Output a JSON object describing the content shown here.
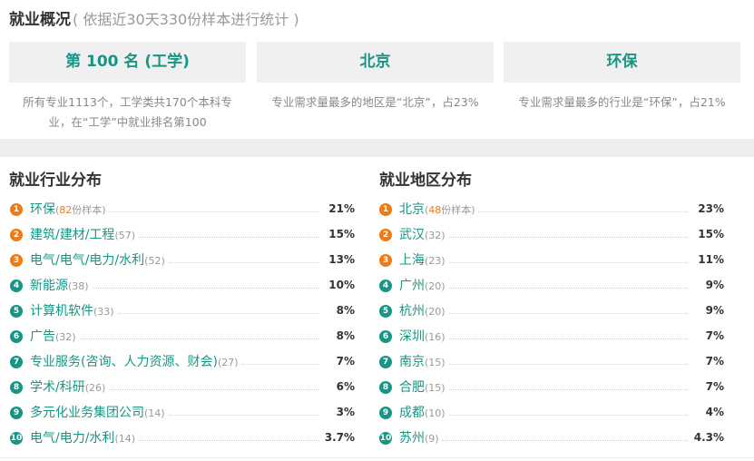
{
  "header": {
    "title": "就业概况",
    "subtitle": "( 依据近30天330份样本进行统计 )"
  },
  "cards": [
    {
      "value": "第 100 名 (工学)",
      "desc": "所有专业1113个，工学类共170个本科专业，在“工学”中就业排名第100"
    },
    {
      "value": "北京",
      "desc": "专业需求量最多的地区是“北京”，占23%"
    },
    {
      "value": "环保",
      "desc": "专业需求量最多的行业是“环保”，占21%"
    }
  ],
  "industry": {
    "title": "就业行业分布",
    "items": [
      {
        "rank": "1",
        "name": "环保",
        "pre": "(",
        "count": "82",
        "post": "份样本)",
        "pct": "21%"
      },
      {
        "rank": "2",
        "name": "建筑/建材/工程",
        "pre": "(",
        "count": "57",
        "post": ")",
        "pct": "15%"
      },
      {
        "rank": "3",
        "name": "电气/电气/电力/水利",
        "pre": "(",
        "count": "52",
        "post": ")",
        "pct": "13%"
      },
      {
        "rank": "4",
        "name": "新能源",
        "pre": "(",
        "count": "38",
        "post": ")",
        "pct": "10%"
      },
      {
        "rank": "5",
        "name": "计算机软件",
        "pre": "(",
        "count": "33",
        "post": ")",
        "pct": "8%"
      },
      {
        "rank": "6",
        "name": "广告",
        "pre": "(",
        "count": "32",
        "post": ")",
        "pct": "8%"
      },
      {
        "rank": "7",
        "name": "专业服务(咨询、人力资源、财会)",
        "pre": "(",
        "count": "27",
        "post": ")",
        "pct": "7%"
      },
      {
        "rank": "8",
        "name": "学术/科研",
        "pre": "(",
        "count": "26",
        "post": ")",
        "pct": "6%"
      },
      {
        "rank": "9",
        "name": "多元化业务集团公司",
        "pre": "(",
        "count": "14",
        "post": ")",
        "pct": "3%"
      },
      {
        "rank": "10",
        "name": "电气/电力/水利",
        "pre": "(",
        "count": "14",
        "post": ")",
        "pct": "3.7%"
      }
    ]
  },
  "region": {
    "title": "就业地区分布",
    "items": [
      {
        "rank": "1",
        "name": "北京",
        "pre": "(",
        "count": "48",
        "post": "份样本)",
        "pct": "23%"
      },
      {
        "rank": "2",
        "name": "武汉",
        "pre": "(",
        "count": "32",
        "post": ")",
        "pct": "15%"
      },
      {
        "rank": "3",
        "name": "上海",
        "pre": "(",
        "count": "23",
        "post": ")",
        "pct": "11%"
      },
      {
        "rank": "4",
        "name": "广州",
        "pre": "(",
        "count": "20",
        "post": ")",
        "pct": "9%"
      },
      {
        "rank": "5",
        "name": "杭州",
        "pre": "(",
        "count": "20",
        "post": ")",
        "pct": "9%"
      },
      {
        "rank": "6",
        "name": "深圳",
        "pre": "(",
        "count": "16",
        "post": ")",
        "pct": "7%"
      },
      {
        "rank": "7",
        "name": "南京",
        "pre": "(",
        "count": "15",
        "post": ")",
        "pct": "7%"
      },
      {
        "rank": "8",
        "name": "合肥",
        "pre": "(",
        "count": "15",
        "post": ")",
        "pct": "7%"
      },
      {
        "rank": "9",
        "name": "成都",
        "pre": "(",
        "count": "10",
        "post": ")",
        "pct": "4%"
      },
      {
        "rank": "10",
        "name": "苏州",
        "pre": "(",
        "count": "9",
        "post": ")",
        "pct": "4.3%"
      }
    ]
  },
  "colors": {
    "accent": "#199585",
    "highlight": "#f07b15"
  }
}
